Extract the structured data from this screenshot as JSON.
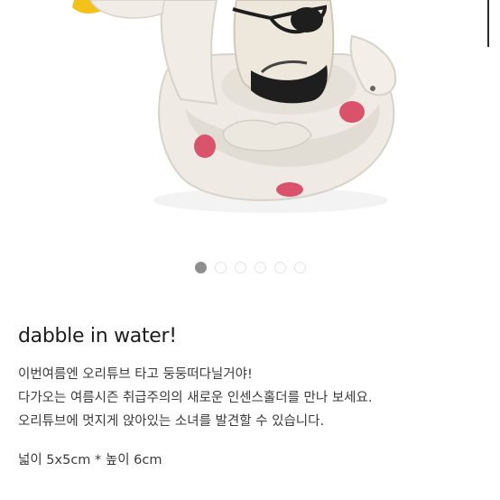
{
  "carousel": {
    "image_alt": "",
    "dot_count": 6,
    "active_index": 0
  },
  "product": {
    "title": "dabble in water!",
    "description": [
      "이번여름엔 오리튜브 타고 둥둥떠다닐거야!",
      "다가오는 여름시즌 취급주의의 새로운 인센스홀더를 만나 보세요.",
      "오리튜브에 멋지게 앉아있는 소녀를 발견할 수 있습니다."
    ],
    "size": "넓이 5x5cm * 높이 6cm"
  },
  "colors": {
    "ceramic": "#f1ede6",
    "polka_dot": "#d9546b",
    "beak": "#f2c21a",
    "dot_active": "#8e8e8e",
    "dot_inactive": "#e4e4e4"
  }
}
